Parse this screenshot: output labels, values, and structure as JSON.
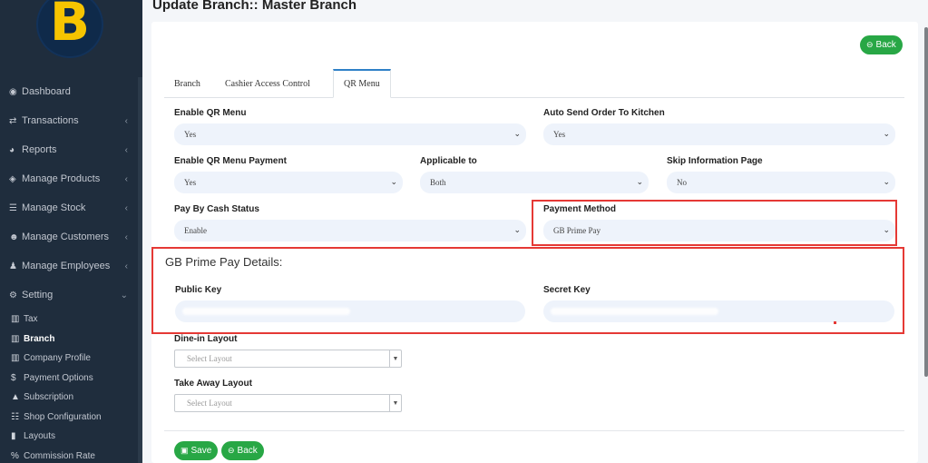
{
  "app": {
    "logo_letter": "B",
    "brand_color": "#f6c400",
    "sidebar_bg": "#1f2d3d",
    "accent_green": "#28a745",
    "highlight_red": "#e53935"
  },
  "header": {
    "title": "Update Branch:: Master Branch"
  },
  "sidebar": {
    "items": [
      {
        "label": "Dashboard",
        "icon": "palette-icon",
        "glyph": "◉",
        "chevron": ""
      },
      {
        "label": "Transactions",
        "icon": "exchange-icon",
        "glyph": "⇄",
        "chevron": "‹"
      },
      {
        "label": "Reports",
        "icon": "chart-pie-icon",
        "glyph": "◕",
        "chevron": "‹"
      },
      {
        "label": "Manage Products",
        "icon": "cube-icon",
        "glyph": "◈",
        "chevron": "‹"
      },
      {
        "label": "Manage Stock",
        "icon": "database-icon",
        "glyph": "☰",
        "chevron": "‹"
      },
      {
        "label": "Manage Customers",
        "icon": "users-icon",
        "glyph": "☻",
        "chevron": "‹"
      },
      {
        "label": "Manage Employees",
        "icon": "user-icon",
        "glyph": "♟",
        "chevron": "‹"
      },
      {
        "label": "Setting",
        "icon": "cogs-icon",
        "glyph": "⚙",
        "chevron": "⌄"
      }
    ],
    "sub_items": [
      {
        "label": "Tax",
        "icon": "bank-icon",
        "glyph": "▥"
      },
      {
        "label": "Branch",
        "icon": "bank-icon",
        "glyph": "▥"
      },
      {
        "label": "Company Profile",
        "icon": "bank-icon",
        "glyph": "▥"
      },
      {
        "label": "Payment Options",
        "icon": "dollar-icon",
        "glyph": "$"
      },
      {
        "label": "Subscription",
        "icon": "subscription-icon",
        "glyph": "▲"
      },
      {
        "label": "Shop Configuration",
        "icon": "list-icon",
        "glyph": "☷"
      },
      {
        "label": "Layouts",
        "icon": "file-icon",
        "glyph": "▮"
      },
      {
        "label": "Commission Rate",
        "icon": "percent-icon",
        "glyph": "%"
      }
    ]
  },
  "actions": {
    "back_label": "Back",
    "save_label": "Save",
    "back_icon": "circle-arrow-left-icon",
    "save_icon": "save-icon"
  },
  "tabs": [
    {
      "label": "Branch",
      "active": false
    },
    {
      "label": "Cashier Access Control",
      "active": false
    },
    {
      "label": "QR Menu",
      "active": true
    }
  ],
  "form": {
    "enable_qr_menu": {
      "label": "Enable QR Menu",
      "value": "Yes"
    },
    "auto_send_order": {
      "label": "Auto Send Order To Kitchen",
      "value": "Yes"
    },
    "enable_qr_payment": {
      "label": "Enable QR Menu Payment",
      "value": "Yes"
    },
    "applicable_to": {
      "label": "Applicable to",
      "value": "Both"
    },
    "skip_info_page": {
      "label": "Skip Information Page",
      "value": "No"
    },
    "pay_by_cash": {
      "label": "Pay By Cash Status",
      "value": "Enable"
    },
    "payment_method": {
      "label": "Payment Method",
      "value": "GB Prime Pay"
    },
    "gb_section_title": "GB Prime Pay Details:",
    "public_key": {
      "label": "Public Key"
    },
    "secret_key": {
      "label": "Secret Key"
    },
    "dine_in_layout": {
      "label": "Dine-in Layout",
      "placeholder": "Select Layout"
    },
    "take_away_layout": {
      "label": "Take Away Layout",
      "placeholder": "Select Layout"
    }
  }
}
